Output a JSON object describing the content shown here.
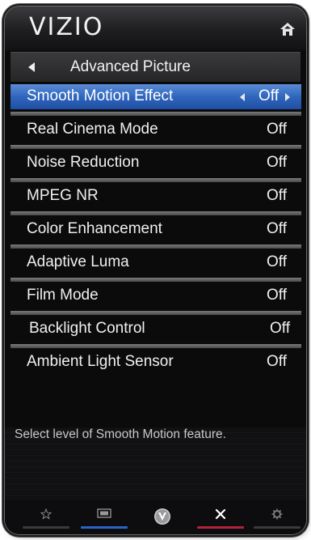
{
  "header": {
    "logo": "VIZIO"
  },
  "submenu": {
    "title": "Advanced Picture"
  },
  "menu": {
    "items": [
      {
        "label": "Smooth Motion Effect",
        "value": "Off"
      },
      {
        "label": "Real Cinema Mode",
        "value": "Off"
      },
      {
        "label": "Noise Reduction",
        "value": "Off"
      },
      {
        "label": "MPEG NR",
        "value": "Off"
      },
      {
        "label": "Color Enhancement",
        "value": "Off"
      },
      {
        "label": "Adaptive Luma",
        "value": "Off"
      },
      {
        "label": "Film Mode",
        "value": "Off"
      },
      {
        "label": "Backlight Control",
        "value": "Off"
      },
      {
        "label": "Ambient Light Sensor",
        "value": "Off"
      }
    ]
  },
  "help": {
    "text": "Select level of Smooth Motion feature."
  },
  "bottom_bar": {
    "icons": [
      "star-icon",
      "screen-icon",
      "vizio-v-icon",
      "close-icon",
      "gear-icon"
    ],
    "colors": {
      "yellow": "#c9b021",
      "blue": "#2c63c8",
      "red": "#b3213b",
      "accent": "#2f66bd"
    }
  }
}
